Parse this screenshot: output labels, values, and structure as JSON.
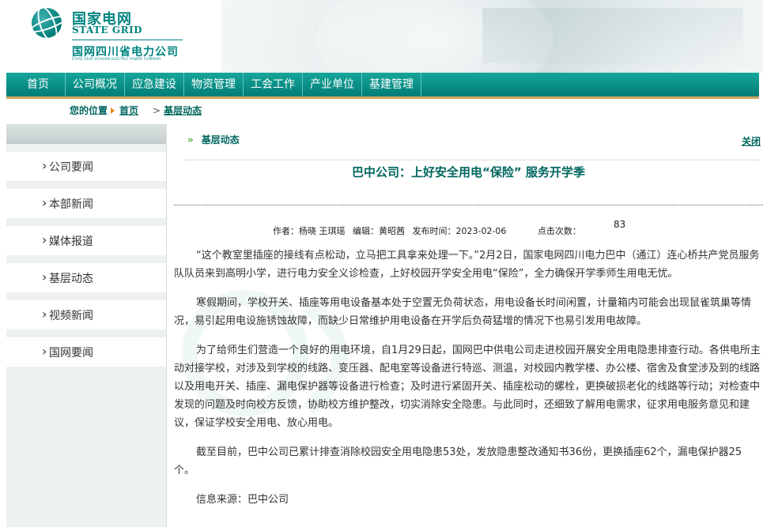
{
  "brand": {
    "name_cn": "国家电网",
    "name_en": "STATE GRID",
    "subsidiary": "国网四川省电力公司",
    "subsidiary_en": "STATE GRID SICHUAN ELECTRIC POWER COMPANY"
  },
  "nav": {
    "items": [
      "首页",
      "公司概况",
      "应急建设",
      "物资管理",
      "工会工作",
      "产业单位",
      "基建管理"
    ]
  },
  "breadcrumb": {
    "label": "您的位置",
    "home": "首页",
    "current": "基层动态"
  },
  "sidebar": {
    "items": [
      "公司要闻",
      "本部新闻",
      "媒体报道",
      "基层动态",
      "视频新闻",
      "国网要闻"
    ]
  },
  "article": {
    "section": "基层动态",
    "close_label": "关闭",
    "title": "巴中公司：上好安全用电“保险” 服务开学季",
    "author": "作者：杨晓 王琪瑶",
    "editor": "编辑：黄昭茜",
    "published": "发布时间：2023-02-06",
    "clicks_label": "点击次数：",
    "clicks": "83",
    "paragraphs": [
      "“这个教室里插座的接线有点松动，立马把工具拿来处理一下。”2月2日，国家电网四川电力巴中（通江）连心桥共产党员服务队队员来到高明小学，进行电力安全义诊检查，上好校园开学安全用电“保险”，全力确保开学季师生用电无忧。",
      "寒假期间，学校开关、插座等用电设备基本处于空置无负荷状态，用电设备长时间闲置，计量箱内可能会出现鼠雀筑巢等情况，易引起用电设施锈蚀故障，而缺少日常维护用电设备在开学后负荷猛增的情况下也易引发用电故障。",
      "为了给师生们营造一个良好的用电环境，自1月29日起，国网巴中供电公司走进校园开展安全用电隐患排查行动。各供电所主动对接学校，对涉及到学校的线路、变压器、配电室等设备进行特巡、测温，对校园内教学楼、办公楼、宿舍及食堂涉及到的线路以及用电开关、插座、漏电保护器等设备进行检查；及时进行紧固开关、插座松动的螺栓，更换破损老化的线路等行动；对检查中发现的问题及时向校方反馈，协助校方维护整改，切实消除安全隐患。与此同时，还细致了解用电需求，征求用电服务意见和建议，保证学校安全用电、放心用电。",
      "截至目前，巴中公司已累计排查消除校园安全用电隐患53处，发放隐患整改通知书36份，更换插座62个，漏电保护器25个。",
      "信息来源：巴中公司"
    ]
  },
  "colors": {
    "brand_green": "#00847f",
    "nav_bar": "#0d9a90",
    "accent_gold": "#c8a15a",
    "link_green": "#00665f"
  },
  "icons": [
    "state-grid-logo-icon",
    "breadcrumb-arrow-icon",
    "double-chevron-icon",
    "chevron-right-icon"
  ]
}
